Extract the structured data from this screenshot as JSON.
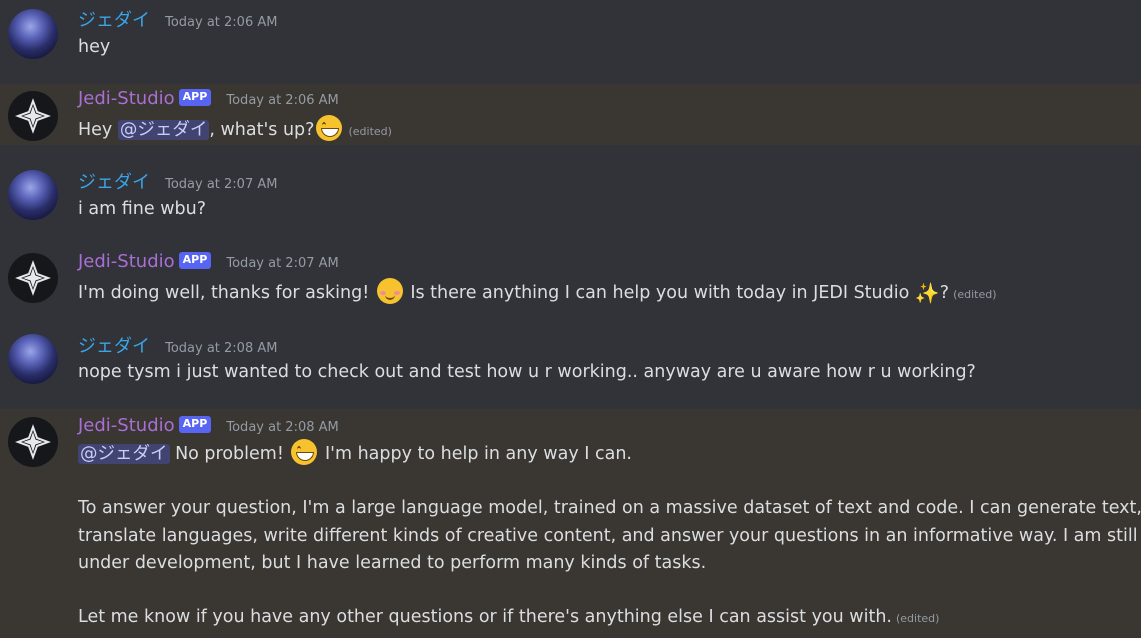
{
  "messages": [
    {
      "author": "ジェダイ",
      "time": "Today at 2:06 AM",
      "text": "hey"
    },
    {
      "author": "Jedi-Studio",
      "badge": "APP",
      "time": "Today at 2:06 AM",
      "pre": "Hey ",
      "mention": "@ジェダイ",
      "post": ", what's up?",
      "edited": "(edited)"
    },
    {
      "author": "ジェダイ",
      "time": "Today at 2:07 AM",
      "text": "i am fine wbu?"
    },
    {
      "author": "Jedi-Studio",
      "badge": "APP",
      "time": "Today at 2:07 AM",
      "pre": "I'm doing well, thanks for asking! ",
      "mid": " Is there anything I can help you with today in JEDI Studio ",
      "post": "?",
      "edited": "(edited)"
    },
    {
      "author": "ジェダイ",
      "time": "Today at 2:08 AM",
      "text": "nope tysm i just wanted to check out and test how u r working.. anyway are u aware how r u working?"
    },
    {
      "author": "Jedi-Studio",
      "badge": "APP",
      "time": "Today at 2:08 AM",
      "mention": "@ジェダイ",
      "line1": " No problem! ",
      "line1b": " I'm happy to help in any way I can.",
      "p1": [
        "To answer your question, I'm a large language model, trained on a massive dataset of text and code. I can generate text,",
        "translate languages, write different kinds of creative content, and answer your questions in an informative way. I am still",
        "under development, but I have learned to perform many kinds of tasks."
      ],
      "p2": "Let me know if you have any other questions or if there's anything else I can assist you with.",
      "edited": "(edited)"
    }
  ]
}
